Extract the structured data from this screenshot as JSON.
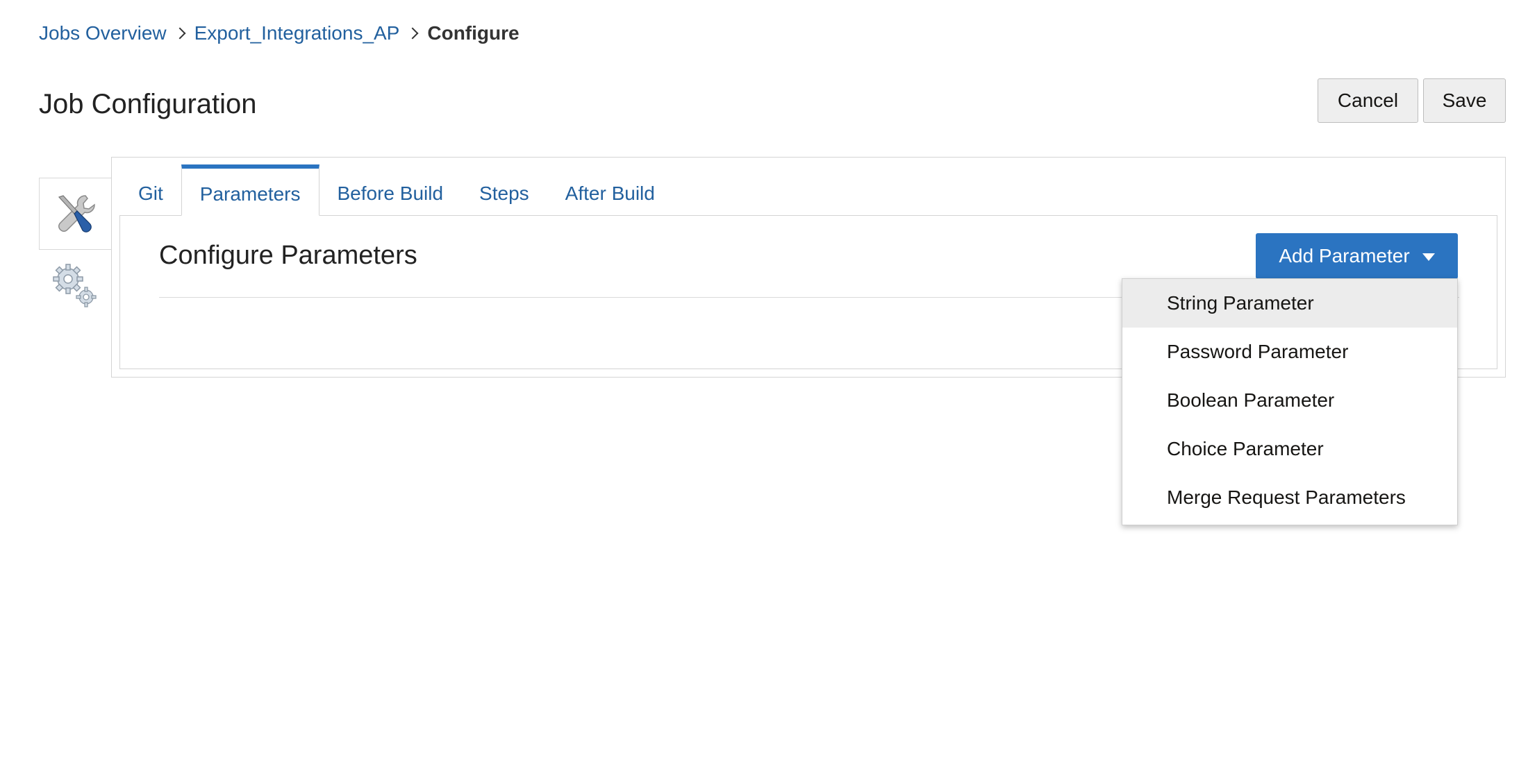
{
  "breadcrumb": {
    "items": [
      "Jobs Overview",
      "Export_Integrations_AP"
    ],
    "current": "Configure"
  },
  "page": {
    "title": "Job Configuration"
  },
  "header": {
    "cancel_label": "Cancel",
    "save_label": "Save"
  },
  "rail": {
    "items": [
      {
        "icon": "tools-icon",
        "active": true
      },
      {
        "icon": "gears-icon",
        "active": false
      }
    ]
  },
  "tabs": [
    {
      "label": "Git",
      "active": false
    },
    {
      "label": "Parameters",
      "active": true
    },
    {
      "label": "Before Build",
      "active": false
    },
    {
      "label": "Steps",
      "active": false
    },
    {
      "label": "After Build",
      "active": false
    }
  ],
  "section": {
    "title": "Configure Parameters",
    "add_button_label": "Add Parameter"
  },
  "menu": {
    "items": [
      "String Parameter",
      "Password Parameter",
      "Boolean Parameter",
      "Choice Parameter",
      "Merge Request Parameters"
    ],
    "highlighted_index": 0
  },
  "colors": {
    "link": "#22609e",
    "accent": "#2b74c1",
    "text": "#161513"
  }
}
